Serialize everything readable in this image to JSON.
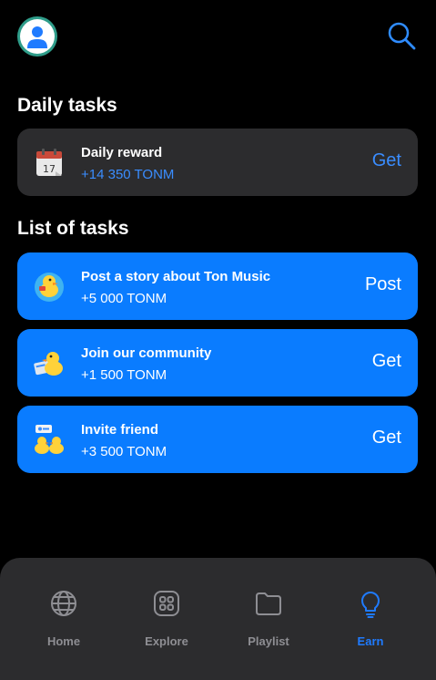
{
  "header": {
    "avatar_icon": "user-avatar-icon",
    "search_icon": "search-icon"
  },
  "daily": {
    "title": "Daily tasks",
    "items": [
      {
        "title": "Daily reward",
        "reward": "+14 350 TONM",
        "action": "Get",
        "icon": "calendar-icon"
      }
    ]
  },
  "tasks": {
    "title": "List of tasks",
    "items": [
      {
        "title": "Post a story about Ton Music",
        "reward": "+5 000 TONM",
        "action": "Post",
        "icon": "duck-story-icon"
      },
      {
        "title": "Join our community",
        "reward": "+1 500 TONM",
        "action": "Get",
        "icon": "duck-community-icon"
      },
      {
        "title": "Invite friend",
        "reward": "+3 500 TONM",
        "action": "Get",
        "icon": "duck-friends-icon"
      }
    ]
  },
  "nav": {
    "items": [
      {
        "label": "Home",
        "icon": "globe-icon",
        "active": false
      },
      {
        "label": "Explore",
        "icon": "grid-icon",
        "active": false
      },
      {
        "label": "Playlist",
        "icon": "folder-icon",
        "active": false
      },
      {
        "label": "Earn",
        "icon": "lightbulb-icon",
        "active": true
      }
    ]
  },
  "colors": {
    "background": "#000000",
    "card_dark": "#2c2c2e",
    "card_blue": "#0a7cff",
    "accent": "#3a8dff",
    "nav_inactive": "#8e8e93"
  }
}
